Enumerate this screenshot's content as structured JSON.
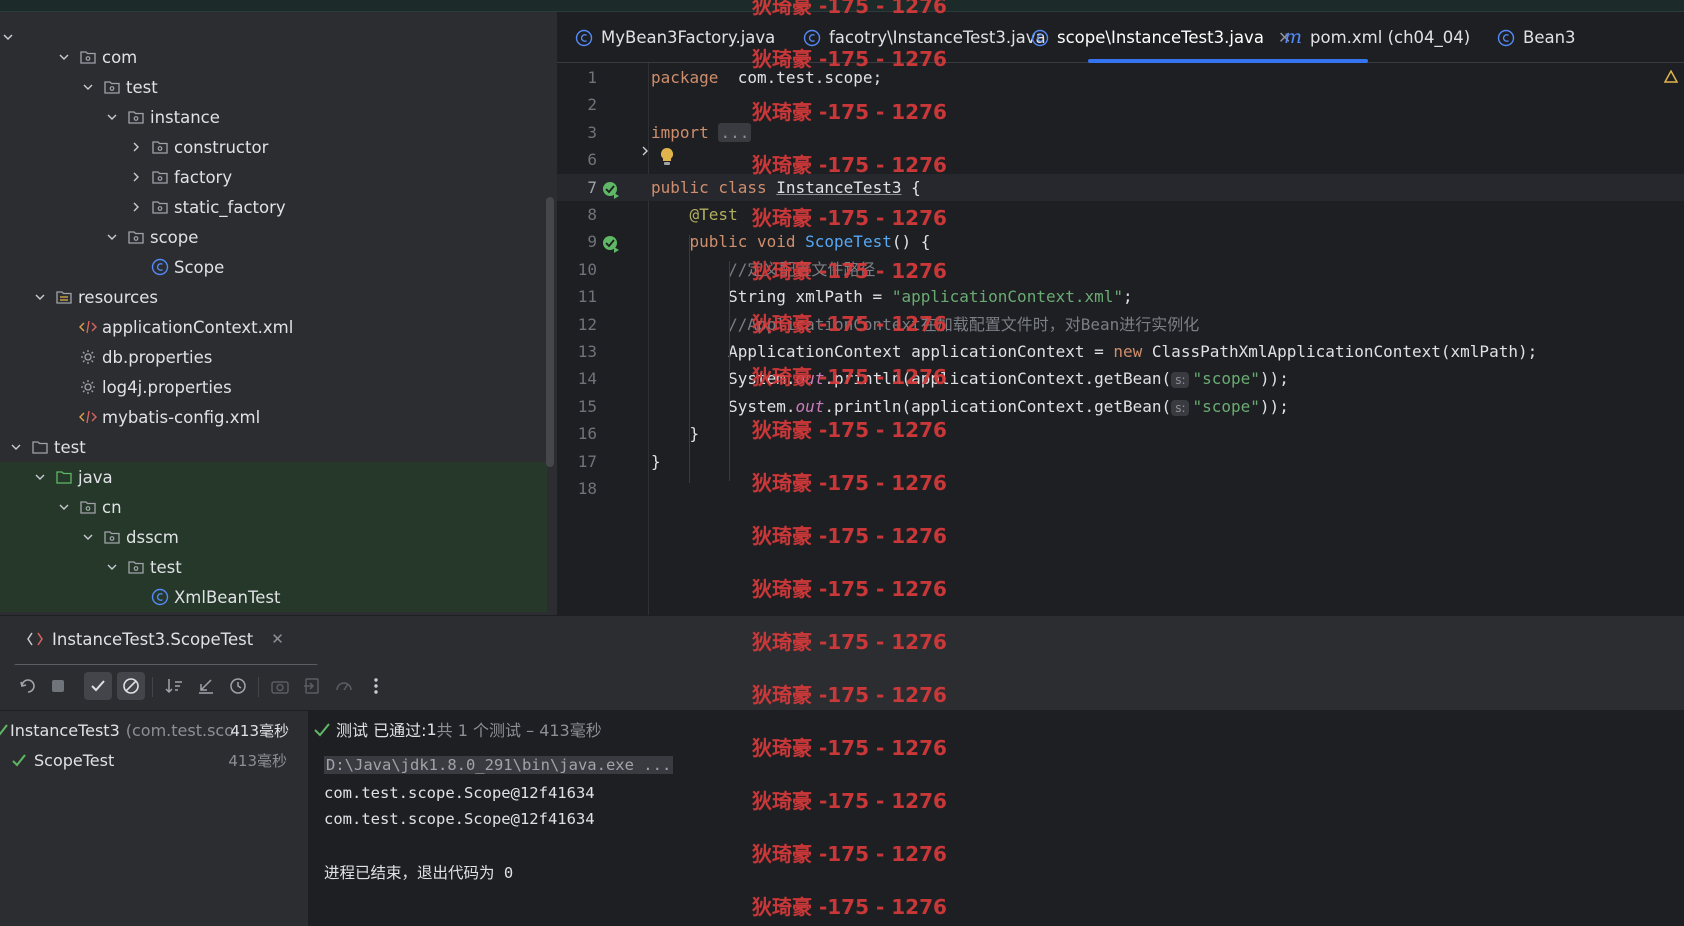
{
  "project_tree": {
    "rows": [
      {
        "label": "com",
        "indent": 3,
        "expanded": true,
        "icon": "package-icon"
      },
      {
        "label": "test",
        "indent": 4,
        "expanded": true,
        "icon": "package-icon"
      },
      {
        "label": "instance",
        "indent": 5,
        "expanded": true,
        "icon": "package-icon"
      },
      {
        "label": "constructor",
        "indent": 6,
        "expanded": false,
        "icon": "package-icon"
      },
      {
        "label": "factory",
        "indent": 6,
        "expanded": false,
        "icon": "package-icon"
      },
      {
        "label": "static_factory",
        "indent": 6,
        "expanded": false,
        "icon": "package-icon"
      },
      {
        "label": "scope",
        "indent": 5,
        "expanded": true,
        "icon": "package-icon"
      },
      {
        "label": "Scope",
        "indent": 6,
        "leaf": true,
        "icon": "class-icon"
      },
      {
        "label": "resources",
        "indent": 2,
        "expanded": true,
        "icon": "resources-folder-icon"
      },
      {
        "label": "applicationContext.xml",
        "indent": 3,
        "leaf": true,
        "icon": "xml-icon"
      },
      {
        "label": "db.properties",
        "indent": 3,
        "leaf": true,
        "icon": "properties-icon"
      },
      {
        "label": "log4j.properties",
        "indent": 3,
        "leaf": true,
        "icon": "properties-icon"
      },
      {
        "label": "mybatis-config.xml",
        "indent": 3,
        "leaf": true,
        "icon": "xml-icon"
      },
      {
        "label": "test",
        "indent": 1,
        "expanded": true,
        "icon": "folder-icon"
      },
      {
        "label": "java",
        "indent": 2,
        "expanded": true,
        "icon": "test-source-folder-icon",
        "green": true
      },
      {
        "label": "cn",
        "indent": 3,
        "expanded": true,
        "icon": "package-icon",
        "green": true
      },
      {
        "label": "dsscm",
        "indent": 4,
        "expanded": true,
        "icon": "package-icon",
        "green": true
      },
      {
        "label": "test",
        "indent": 5,
        "expanded": true,
        "icon": "package-icon",
        "green": true
      },
      {
        "label": "XmlBeanTest",
        "indent": 6,
        "leaf": true,
        "icon": "class-icon",
        "green": true
      }
    ]
  },
  "tabs": [
    {
      "label": "MyBean3Factory.java",
      "icon": "class-icon",
      "active": false
    },
    {
      "label": "facotry\\InstanceTest3.java",
      "icon": "class-icon",
      "active": false
    },
    {
      "label": "scope\\InstanceTest3.java",
      "icon": "class-icon",
      "active": true
    },
    {
      "label": "pom.xml (ch04_04)",
      "icon": "maven-icon",
      "active": false
    },
    {
      "label": "Bean3",
      "icon": "class-icon",
      "active": false
    }
  ],
  "editor": {
    "lines": [
      {
        "n": "1",
        "tokens": [
          [
            "kw",
            "package"
          ],
          [
            "",
            "  com.test.scope;"
          ]
        ]
      },
      {
        "n": "2",
        "tokens": []
      },
      {
        "n": "3",
        "tokens": [
          [
            "kw",
            "import"
          ],
          [
            "",
            " "
          ],
          [
            "fold",
            "..."
          ]
        ]
      },
      {
        "n": "6",
        "tokens": []
      },
      {
        "n": "7",
        "tokens": [
          [
            "kw",
            "public class"
          ],
          [
            "",
            " "
          ],
          [
            "under",
            "InstanceTest3"
          ],
          [
            "",
            " {"
          ]
        ]
      },
      {
        "n": "8",
        "tokens": [
          [
            "",
            ""
          ],
          [
            "ann",
            "    @Test"
          ]
        ]
      },
      {
        "n": "9",
        "tokens": [
          [
            "kw",
            "    public void"
          ],
          [
            "",
            " "
          ],
          [
            "fn",
            "ScopeTest"
          ],
          [
            "",
            "() {"
          ]
        ]
      },
      {
        "n": "10",
        "tokens": [
          [
            "cm",
            "        //定义配置文件路径"
          ]
        ]
      },
      {
        "n": "11",
        "tokens": [
          [
            "",
            "        String xmlPath = "
          ],
          [
            "str",
            "\"applicationContext.xml\""
          ],
          [
            "",
            ";"
          ]
        ]
      },
      {
        "n": "12",
        "tokens": [
          [
            "cm",
            "        //ApplicationContext在加载配置文件时，对Bean进行实例化"
          ]
        ]
      },
      {
        "n": "13",
        "tokens": [
          [
            "",
            "        ApplicationContext applicationContext = "
          ],
          [
            "kw",
            "new"
          ],
          [
            "",
            " ClassPathXmlApplicationContext(xmlPath);"
          ]
        ]
      },
      {
        "n": "14",
        "tokens": [
          [
            "",
            "        System."
          ],
          [
            "fld",
            "out"
          ],
          [
            "",
            ".println(applicationContext.getBean("
          ],
          [
            "hint",
            "s:"
          ],
          [
            "str",
            "\"scope\""
          ],
          [
            "",
            "));"
          ]
        ]
      },
      {
        "n": "15",
        "tokens": [
          [
            "",
            "        System."
          ],
          [
            "fld",
            "out"
          ],
          [
            "",
            ".println(applicationContext.getBean("
          ],
          [
            "hint",
            "s:"
          ],
          [
            "str",
            "\"scope\""
          ],
          [
            "",
            "));"
          ]
        ]
      },
      {
        "n": "16",
        "tokens": [
          [
            "",
            "    }"
          ]
        ]
      },
      {
        "n": "17",
        "tokens": [
          [
            "",
            "}"
          ]
        ]
      },
      {
        "n": "18",
        "tokens": []
      }
    ],
    "current_line": "7"
  },
  "run": {
    "tab_label": "InstanceTest3.ScopeTest",
    "test_tree": [
      {
        "label": "InstanceTest3",
        "detail": "(com.test.sco",
        "time": "413毫秒"
      },
      {
        "label": "ScopeTest",
        "detail": "",
        "time": "413毫秒"
      }
    ],
    "status_prefix": "测试 已通过: ",
    "status_count": "1",
    "status_suffix": "共 1 个测试 – 413毫秒",
    "console_lines": [
      "D:\\Java\\jdk1.8.0_291\\bin\\java.exe ...",
      "com.test.scope.Scope@12f41634",
      "com.test.scope.Scope@12f41634",
      "",
      "进程已结束，退出代码为 0"
    ]
  },
  "watermark": "狄琦豪 -175 - 1276",
  "colors": {
    "accent": "#3574f0",
    "success": "#5fb865",
    "watermark": "#d93a3a"
  }
}
